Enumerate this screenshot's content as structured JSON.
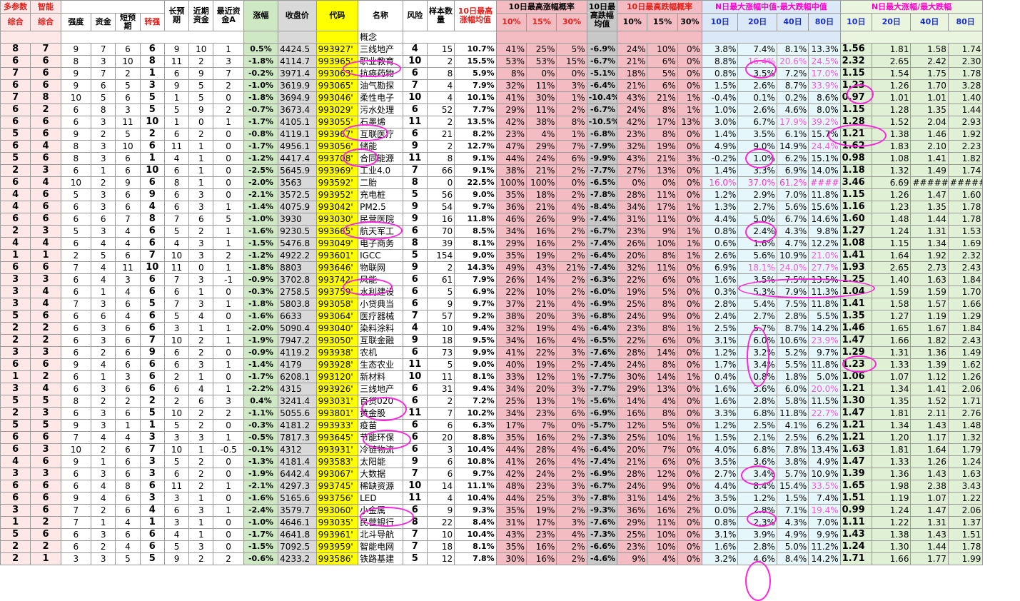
{
  "headers": {
    "row1": {
      "multi": "多参数",
      "smart": "智能",
      "long": "长预期",
      "recent": "近期资金",
      "recentA": "最近资金A",
      "samples": "样本数量",
      "avg10": "10日最高涨幅均值",
      "prob_up": "10日最高涨幅概率",
      "avg_down": "10日最高跌幅均值",
      "prob_down": "10日最高跌幅概率",
      "median_diff": "N日最大涨幅中值-最大跌幅中值",
      "ratio": "N日最大涨幅/最大跌幅"
    },
    "row2": {
      "zonghe1": "综合",
      "zonghe2": "综合",
      "strength": "强度",
      "fund": "资金",
      "short": "短预期",
      "turn": "转强",
      "chg": "涨幅",
      "close": "收盘价",
      "code": "代码",
      "name": "名称",
      "risk": "风险",
      "p10": "10%",
      "p15": "15%",
      "p30": "30%",
      "d10": "10%",
      "d15": "15%",
      "d30": "30%",
      "n10": "10日",
      "n20": "20日",
      "n40": "40日",
      "n80": "80日",
      "r10": "10日",
      "r20": "20日",
      "r40": "40日",
      "r80": "80日"
    },
    "concept_label": "概念"
  },
  "rows": [
    [
      "8",
      "7",
      "9",
      "7",
      "6",
      "6",
      "9",
      "10",
      "1",
      "0.5%",
      "4424.5",
      "993927'",
      "三线地产",
      "4",
      "15",
      "10.7%",
      "41%",
      "25%",
      "5%",
      "-6.9%",
      "24%",
      "10%",
      "0%",
      "3.8%",
      "7.4%",
      "8.1%",
      "13.3%",
      "1.56",
      "1.81",
      "1.58",
      "1.74"
    ],
    [
      "6",
      "6",
      "8",
      "3",
      "10",
      "8",
      "11",
      "2",
      "3",
      "-1.8%",
      "4114.7",
      "993965'",
      "职业教育",
      "10",
      "2",
      "15.5%",
      "53%",
      "53%",
      "15%",
      "-6.7%",
      "21%",
      "6%",
      "0%",
      "8.8%",
      "16.4%",
      "20.6%",
      "24.5%",
      "2.32",
      "2.65",
      "2.42",
      "2.30"
    ],
    [
      "7",
      "6",
      "9",
      "7",
      "2",
      "1",
      "6",
      "9",
      "7",
      "-0.2%",
      "3971.4",
      "993063'",
      "抗癌药物",
      "6",
      "8",
      "5.9%",
      "8%",
      "0%",
      "0%",
      "-5.1%",
      "18%",
      "5%",
      "0%",
      "0.8%",
      "3.5%",
      "7.2%",
      "17.0%",
      "1.15",
      "1.54",
      "1.75",
      "1.78"
    ],
    [
      "6",
      "6",
      "9",
      "6",
      "5",
      "3",
      "9",
      "5",
      "2",
      "-1.0%",
      "3619.9",
      "993065'",
      "油气勘探",
      "7",
      "4",
      "7.9%",
      "32%",
      "11%",
      "3%",
      "-6.4%",
      "21%",
      "6%",
      "0%",
      "1.5%",
      "2.6%",
      "8.7%",
      "33.9%",
      "1.23",
      "1.26",
      "1.70",
      "3.28"
    ],
    [
      "7",
      "8",
      "10",
      "5",
      "6",
      "5",
      "1",
      "5",
      "0",
      "-1.8%",
      "3694.9",
      "993046'",
      "柔性电子",
      "10",
      "4",
      "10.1%",
      "41%",
      "30%",
      "1%",
      "-10.4%",
      "43%",
      "21%",
      "1%",
      "-0.4%",
      "0.1%",
      "0.2%",
      "8.6%",
      "0.97",
      "1.01",
      "1.01",
      "1.40"
    ],
    [
      "6",
      "2",
      "6",
      "8",
      "3",
      "5",
      "5",
      "9",
      "2",
      "-0.7%",
      "3673.4",
      "993029'",
      "污水处理",
      "6",
      "52",
      "7.7%",
      "29%",
      "11%",
      "2%",
      "-6.7%",
      "24%",
      "8%",
      "1%",
      "1.0%",
      "2.6%",
      "4.6%",
      "8.0%",
      "1.15",
      "1.28",
      "1.35",
      "1.44"
    ],
    [
      "6",
      "6",
      "6",
      "3",
      "11",
      "10",
      "1",
      "0",
      "1",
      "-1.7%",
      "4105.1",
      "993055'",
      "石墨烯",
      "11",
      "2",
      "13.5%",
      "42%",
      "38%",
      "8%",
      "-10.5%",
      "42%",
      "17%",
      "13%",
      "3.0%",
      "6.7%",
      "17.9%",
      "39.2%",
      "1.28",
      "1.52",
      "2.04",
      "2.93"
    ],
    [
      "5",
      "6",
      "9",
      "2",
      "5",
      "2",
      "6",
      "2",
      "0",
      "-0.8%",
      "4119.1",
      "993967'",
      "互联医疗",
      "6",
      "21",
      "8.2%",
      "23%",
      "4%",
      "1%",
      "-6.8%",
      "23%",
      "8%",
      "0%",
      "1.4%",
      "3.5%",
      "6.1%",
      "15.7%",
      "1.21",
      "1.38",
      "1.46",
      "1.92"
    ],
    [
      "6",
      "4",
      "8",
      "3",
      "10",
      "6",
      "11",
      "1",
      "0",
      "-1.7%",
      "4956.1",
      "993056'",
      "储能",
      "9",
      "2",
      "12.7%",
      "47%",
      "29%",
      "7%",
      "-7.9%",
      "32%",
      "19%",
      "0%",
      "4.9%",
      "9.0%",
      "14.9%",
      "24.4%",
      "1.62",
      "1.83",
      "2.10",
      "2.23"
    ],
    [
      "5",
      "6",
      "8",
      "3",
      "6",
      "1",
      "4",
      "1",
      "0",
      "-1.2%",
      "4417.4",
      "993708'",
      "合同能源",
      "11",
      "8",
      "9.1%",
      "44%",
      "24%",
      "6%",
      "-9.9%",
      "43%",
      "21%",
      "3%",
      "-0.2%",
      "1.0%",
      "6.2%",
      "15.1%",
      "0.98",
      "1.08",
      "1.41",
      "1.82"
    ],
    [
      "2",
      "3",
      "6",
      "1",
      "6",
      "10",
      "6",
      "1",
      "0",
      "-2.5%",
      "5645.9",
      "993969'",
      "工业4.0",
      "7",
      "66",
      "9.1%",
      "38%",
      "21%",
      "2%",
      "-7.7%",
      "27%",
      "13%",
      "0%",
      "1.4%",
      "3.3%",
      "6.9%",
      "14.0%",
      "1.18",
      "1.32",
      "1.49",
      "1.74"
    ],
    [
      "6",
      "4",
      "10",
      "2",
      "9",
      "6",
      "8",
      "1",
      "0",
      "-2.0%",
      "3563",
      "993592'",
      "二胎",
      "8",
      "0",
      "22.5%",
      "100%",
      "100%",
      "0%",
      "-6.5%",
      "0%",
      "0%",
      "0%",
      "16.0%",
      "37.0%",
      "61.2%",
      "#####",
      "3.46",
      "6.69",
      "#####",
      "#####"
    ],
    [
      "4",
      "6",
      "5",
      "3",
      "6",
      "9",
      "6",
      "3",
      "0",
      "-2.1%",
      "3572.5",
      "993952'",
      "充电桩",
      "5",
      "56",
      "9.0%",
      "35%",
      "18%",
      "2%",
      "-7.8%",
      "28%",
      "11%",
      "0%",
      "1.2%",
      "2.9%",
      "7.0%",
      "11.8%",
      "1.15",
      "1.26",
      "1.47",
      "1.60"
    ],
    [
      "4",
      "6",
      "6",
      "3",
      "6",
      "4",
      "6",
      "3",
      "1",
      "-1.4%",
      "4075.9",
      "993042'",
      "PM2.5",
      "9",
      "54",
      "9.7%",
      "36%",
      "21%",
      "4%",
      "-8.4%",
      "34%",
      "17%",
      "1%",
      "1.3%",
      "2.7%",
      "5.6%",
      "15.6%",
      "1.16",
      "1.23",
      "1.35",
      "1.78"
    ],
    [
      "6",
      "6",
      "6",
      "6",
      "7",
      "8",
      "7",
      "6",
      "5",
      "-1.0%",
      "3930",
      "993030'",
      "民营医院",
      "9",
      "16",
      "11.8%",
      "46%",
      "26%",
      "9%",
      "-7.4%",
      "31%",
      "11%",
      "0%",
      "4.4%",
      "5.0%",
      "6.7%",
      "14.6%",
      "1.60",
      "1.48",
      "1.44",
      "1.78"
    ],
    [
      "2",
      "3",
      "5",
      "3",
      "4",
      "6",
      "5",
      "2",
      "1",
      "-1.6%",
      "9230.5",
      "993665'",
      "航天军工",
      "6",
      "70",
      "8.5%",
      "34%",
      "16%",
      "2%",
      "-6.7%",
      "23%",
      "9%",
      "1%",
      "0.8%",
      "2.4%",
      "4.3%",
      "9.8%",
      "1.27",
      "1.24",
      "1.31",
      "1.53"
    ],
    [
      "4",
      "4",
      "6",
      "4",
      "4",
      "6",
      "4",
      "3",
      "1",
      "-1.5%",
      "5476.8",
      "993049'",
      "电子商务",
      "8",
      "39",
      "8.1%",
      "29%",
      "16%",
      "2%",
      "-7.4%",
      "26%",
      "10%",
      "1%",
      "0.6%",
      "1.6%",
      "4.7%",
      "12.2%",
      "1.08",
      "1.15",
      "1.34",
      "1.69"
    ],
    [
      "1",
      "1",
      "2",
      "5",
      "6",
      "7",
      "10",
      "3",
      "2",
      "-1.2%",
      "4922.2",
      "993601'",
      "IGCC",
      "5",
      "154",
      "9.0%",
      "35%",
      "19%",
      "2%",
      "-6.4%",
      "20%",
      "8%",
      "1%",
      "2.6%",
      "5.6%",
      "10.9%",
      "21.0%",
      "1.41",
      "1.64",
      "1.92",
      "2.32"
    ],
    [
      "6",
      "6",
      "7",
      "4",
      "11",
      "10",
      "11",
      "0",
      "1",
      "-1.8%",
      "8803",
      "993646'",
      "物联网",
      "9",
      "2",
      "14.3%",
      "49%",
      "43%",
      "21%",
      "-7.4%",
      "32%",
      "11%",
      "0%",
      "6.9%",
      "18.1%",
      "24.0%",
      "27.7%",
      "1.93",
      "2.65",
      "2.73",
      "2.43"
    ],
    [
      "3",
      "3",
      "6",
      "4",
      "3",
      "6",
      "7",
      "3",
      "-1",
      "-0.9%",
      "3702.8",
      "993742'",
      "风能",
      "6",
      "61",
      "7.9%",
      "26%",
      "14%",
      "2%",
      "-6.3%",
      "22%",
      "6%",
      "0%",
      "1.6%",
      "3.5%",
      "7.5%",
      "13.5%",
      "1.25",
      "1.40",
      "1.63",
      "1.84"
    ],
    [
      "3",
      "4",
      "6",
      "1",
      "4",
      "6",
      "6",
      "1",
      "0",
      "-0.3%",
      "2758.5",
      "993759'",
      "水利建设",
      "6",
      "5",
      "6.9%",
      "22%",
      "10%",
      "2%",
      "-6.0%",
      "19%",
      "5%",
      "0%",
      "0.3%",
      "5.3%",
      "7.9%",
      "11.3%",
      "1.04",
      "1.59",
      "1.59",
      "1.70"
    ],
    [
      "3",
      "4",
      "7",
      "3",
      "6",
      "5",
      "7",
      "3",
      "1",
      "-1.8%",
      "5803.8",
      "993058'",
      "小贷典当",
      "6",
      "9",
      "9.7%",
      "37%",
      "21%",
      "4%",
      "-6.9%",
      "25%",
      "8%",
      "0%",
      "2.8%",
      "5.4%",
      "7.5%",
      "11.8%",
      "1.41",
      "1.58",
      "1.57",
      "1.66"
    ],
    [
      "5",
      "6",
      "6",
      "6",
      "4",
      "6",
      "5",
      "4",
      "0",
      "-1.6%",
      "6633",
      "993064'",
      "医疗器械",
      "7",
      "57",
      "9.2%",
      "38%",
      "20%",
      "3%",
      "-6.8%",
      "24%",
      "9%",
      "0%",
      "2.4%",
      "2.7%",
      "2.8%",
      "5.5%",
      "1.35",
      "1.27",
      "1.19",
      "1.29"
    ],
    [
      "2",
      "2",
      "6",
      "3",
      "6",
      "6",
      "3",
      "1",
      "1",
      "-2.0%",
      "5090.4",
      "993040'",
      "染料涂料",
      "4",
      "10",
      "9.4%",
      "32%",
      "19%",
      "4%",
      "-6.4%",
      "23%",
      "8%",
      "1%",
      "2.5%",
      "5.7%",
      "8.7%",
      "14.2%",
      "1.46",
      "1.65",
      "1.67",
      "1.84"
    ],
    [
      "2",
      "2",
      "6",
      "3",
      "6",
      "7",
      "10",
      "2",
      "1",
      "-1.9%",
      "7947.2",
      "993050'",
      "互联金融",
      "9",
      "18",
      "9.5%",
      "34%",
      "16%",
      "4%",
      "-6.5%",
      "22%",
      "6%",
      "0%",
      "3.1%",
      "6.0%",
      "10.6%",
      "23.9%",
      "1.47",
      "1.66",
      "1.82",
      "2.43"
    ],
    [
      "3",
      "3",
      "6",
      "2",
      "6",
      "9",
      "6",
      "2",
      "0",
      "-0.9%",
      "4119.2",
      "993938'",
      "农机",
      "6",
      "73",
      "9.9%",
      "41%",
      "22%",
      "3%",
      "-7.6%",
      "28%",
      "14%",
      "0%",
      "1.2%",
      "3.2%",
      "5.2%",
      "9.7%",
      "1.29",
      "1.31",
      "1.36",
      "1.49"
    ],
    [
      "6",
      "6",
      "9",
      "4",
      "6",
      "6",
      "6",
      "3",
      "1",
      "-1.4%",
      "4179",
      "993928'",
      "生态农业",
      "11",
      "5",
      "9.0%",
      "40%",
      "19%",
      "2%",
      "-7.4%",
      "24%",
      "8%",
      "0%",
      "1.7%",
      "3.4%",
      "5.5%",
      "11.8%",
      "1.23",
      "1.33",
      "1.39",
      "1.62"
    ],
    [
      "1",
      "2",
      "6",
      "1",
      "3",
      "6",
      "2",
      "1",
      "0",
      "-1.7%",
      "6208.1",
      "993120'",
      "新材料",
      "10",
      "11",
      "8.1%",
      "33%",
      "12%",
      "1%",
      "-7.7%",
      "30%",
      "14%",
      "1%",
      "0.4%",
      "0.8%",
      "1.8%",
      "5.0%",
      "1.06",
      "1.07",
      "1.12",
      "1.26"
    ],
    [
      "3",
      "4",
      "6",
      "3",
      "6",
      "6",
      "6",
      "4",
      "1",
      "-2.2%",
      "4315",
      "993926'",
      "三线地产",
      "6",
      "31",
      "9.4%",
      "34%",
      "20%",
      "3%",
      "-7.7%",
      "29%",
      "13%",
      "0%",
      "1.6%",
      "3.6%",
      "6.0%",
      "20.0%",
      "1.21",
      "1.34",
      "1.41",
      "2.06"
    ],
    [
      "5",
      "5",
      "8",
      "2",
      "2",
      "2",
      "2",
      "6",
      "3",
      "0.4%",
      "3241.4",
      "993031'",
      "百货020",
      "6",
      "2",
      "7.2%",
      "25%",
      "13%",
      "1%",
      "-5.6%",
      "14%",
      "4%",
      "0%",
      "1.6%",
      "2.8%",
      "5.8%",
      "11.5%",
      "1.30",
      "1.35",
      "1.52",
      "1.71"
    ],
    [
      "2",
      "3",
      "6",
      "3",
      "6",
      "5",
      "10",
      "2",
      "2",
      "-1.1%",
      "5055.6",
      "993801'",
      "黄金股",
      "11",
      "7",
      "10.2%",
      "34%",
      "23%",
      "6%",
      "-6.9%",
      "16%",
      "8%",
      "0%",
      "3.3%",
      "6.8%",
      "11.8%",
      "22.7%",
      "1.47",
      "1.81",
      "2.11",
      "2.76"
    ],
    [
      "5",
      "5",
      "9",
      "3",
      "1",
      "1",
      "5",
      "2",
      "0",
      "-0.3%",
      "4181.2",
      "993933'",
      "疫苗",
      "6",
      "6",
      "6.3%",
      "17%",
      "7%",
      "0%",
      "-5.7%",
      "12%",
      "5%",
      "0%",
      "1.2%",
      "2.5%",
      "4.1%",
      "6.2%",
      "1.21",
      "1.34",
      "1.43",
      "1.48"
    ],
    [
      "6",
      "6",
      "7",
      "4",
      "4",
      "3",
      "3",
      "3",
      "1",
      "-0.5%",
      "7817.3",
      "993645'",
      "节能环保",
      "6",
      "20",
      "8.8%",
      "35%",
      "16%",
      "2%",
      "-7.3%",
      "25%",
      "10%",
      "1%",
      "1.5%",
      "2.1%",
      "2.5%",
      "6.2%",
      "1.21",
      "1.20",
      "1.17",
      "1.32"
    ],
    [
      "6",
      "3",
      "10",
      "2",
      "6",
      "7",
      "10",
      "1",
      "-0.5",
      "-0.1%",
      "4312",
      "993931'",
      "冷链物流",
      "6",
      "3",
      "10.4%",
      "44%",
      "28%",
      "4%",
      "-6.4%",
      "20%",
      "7%",
      "0%",
      "4.0%",
      "6.8%",
      "7.8%",
      "13.4%",
      "1.63",
      "1.81",
      "1.64",
      "1.79"
    ],
    [
      "4",
      "6",
      "9",
      "1",
      "6",
      "3",
      "5",
      "2",
      "0",
      "-1.3%",
      "4181.4",
      "993583'",
      "太阳能",
      "9",
      "6",
      "10.8%",
      "41%",
      "26%",
      "4%",
      "-7.4%",
      "21%",
      "6%",
      "0%",
      "3.5%",
      "3.6%",
      "3.8%",
      "4.9%",
      "1.47",
      "1.33",
      "1.26",
      "1.24"
    ],
    [
      "3",
      "3",
      "6",
      "3",
      "6",
      "3",
      "6",
      "2",
      "0",
      "-1.9%",
      "6442.4",
      "993067'",
      "大数据",
      "7",
      "6",
      "9.7%",
      "42%",
      "24%",
      "2%",
      "-6.9%",
      "28%",
      "12%",
      "0%",
      "2.7%",
      "3.4%",
      "5.7%",
      "10.9%",
      "1.39",
      "1.36",
      "1.43",
      "1.63"
    ],
    [
      "6",
      "6",
      "6",
      "4",
      "8",
      "6",
      "11",
      "2",
      "1",
      "-2.1%",
      "4297.3",
      "993745'",
      "稀缺资源",
      "10",
      "14",
      "11.1%",
      "48%",
      "23%",
      "3%",
      "-6.7%",
      "24%",
      "9%",
      "0%",
      "4.4%",
      "8.4%",
      "15.4%",
      "33.5%",
      "1.65",
      "1.98",
      "2.38",
      "3.43"
    ],
    [
      "6",
      "6",
      "9",
      "4",
      "6",
      "3",
      "3",
      "1",
      "0",
      "-1.6%",
      "5165.6",
      "993756'",
      "LED",
      "11",
      "4",
      "10.4%",
      "44%",
      "25%",
      "3%",
      "-7.8%",
      "31%",
      "14%",
      "2%",
      "3.5%",
      "1.2%",
      "1.5%",
      "7.4%",
      "1.51",
      "1.19",
      "1.07",
      "1.22"
    ],
    [
      "3",
      "6",
      "7",
      "2",
      "6",
      "4",
      "6",
      "3",
      "1",
      "-2.4%",
      "3579.7",
      "993060'",
      "小金属",
      "6",
      "9",
      "9.3%",
      "35%",
      "19%",
      "2%",
      "-9.3%",
      "36%",
      "16%",
      "2%",
      "0.0%",
      "2.8%",
      "7.1%",
      "19.4%",
      "0.99",
      "1.24",
      "1.47",
      "2.06"
    ],
    [
      "1",
      "2",
      "7",
      "1",
      "4",
      "1",
      "3",
      "1",
      "0",
      "-1.0%",
      "4646.1",
      "993035'",
      "民营银行",
      "8",
      "22",
      "8.4%",
      "31%",
      "17%",
      "3%",
      "-7.6%",
      "29%",
      "11%",
      "0%",
      "0.8%",
      "2.3%",
      "4.3%",
      "7.0%",
      "1.11",
      "1.22",
      "1.31",
      "1.37"
    ],
    [
      "5",
      "6",
      "6",
      "3",
      "6",
      "6",
      "4",
      "1",
      "0",
      "-1.7%",
      "4641.8",
      "993961'",
      "北斗导航",
      "7",
      "10",
      "10.4%",
      "43%",
      "23%",
      "4%",
      "-7.3%",
      "25%",
      "10%",
      "0%",
      "3.1%",
      "3.9%",
      "4.9%",
      "9.9%",
      "1.43",
      "1.38",
      "1.43",
      "1.51"
    ],
    [
      "2",
      "2",
      "6",
      "2",
      "4",
      "6",
      "5",
      "3",
      "0",
      "-1.5%",
      "7092.5",
      "993959'",
      "智能电网",
      "7",
      "18",
      "8.1%",
      "35%",
      "16%",
      "2%",
      "-6.6%",
      "23%",
      "10%",
      "0%",
      "1.6%",
      "2.8%",
      "5.0%",
      "11.2%",
      "1.24",
      "1.30",
      "1.44",
      "1.78"
    ],
    [
      "2",
      "1",
      "3",
      "3",
      "5",
      "5",
      "9",
      "2",
      "2",
      "-0.6%",
      "4233.2",
      "993586'",
      "铁路基建",
      "5",
      "12",
      "7.8%",
      "30%",
      "16%",
      "2%",
      "-4.6%",
      "9%",
      "4%",
      "0%",
      "3.2%",
      "4.6%",
      "8.4%",
      "14.2%",
      "1.71",
      "1.66",
      "1.77",
      "1.99"
    ]
  ]
}
